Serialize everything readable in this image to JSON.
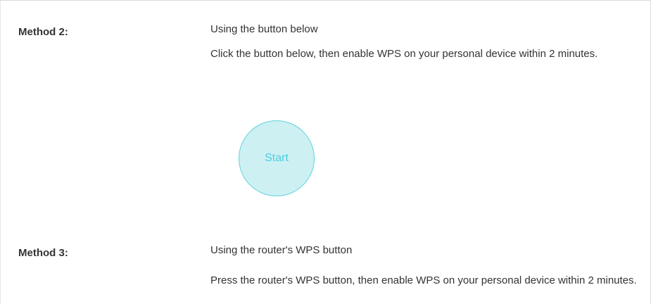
{
  "method2": {
    "label": "Method 2:",
    "heading": "Using the button below",
    "description": "Click the button below, then enable WPS on your personal device within 2 minutes.",
    "button_label": "Start"
  },
  "method3": {
    "label": "Method 3:",
    "heading": "Using the router's WPS button",
    "description": "Press the router's WPS button, then enable WPS on your personal device within 2 minutes."
  },
  "colors": {
    "button_fill": "#cdf0f3",
    "button_border": "#5ed3df",
    "button_text": "#4ccedc",
    "text": "#333333"
  }
}
